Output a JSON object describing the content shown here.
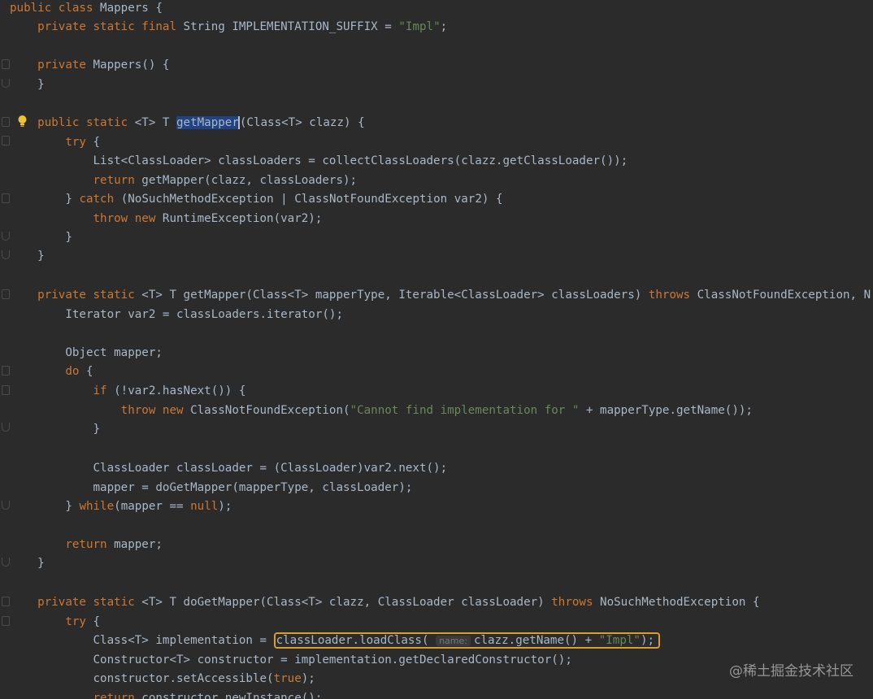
{
  "colors": {
    "background": "#2b2b2b",
    "text": "#a9b7c6",
    "keyword": "#cc7832",
    "string": "#6a8759",
    "selection": "#214283",
    "highlight_box": "#d99e2b"
  },
  "icons": {
    "intention": "lightbulb-icon"
  },
  "code": {
    "line_01": {
      "kw1": "public class",
      "rest": " Mappers {"
    },
    "line_02": {
      "indent": "    ",
      "kw1": "private static final",
      "mid": " String IMPLEMENTATION_SUFFIX = ",
      "str": "\"Impl\"",
      "end": ";"
    },
    "line_04": {
      "indent": "    ",
      "kw1": "private",
      "rest": " Mappers() {"
    },
    "line_05": {
      "indent": "    ",
      "rest": "}"
    },
    "line_07": {
      "indent": "    ",
      "kw1": "public static",
      "mid": " <T> T ",
      "selected": "getMapper",
      "rest": "(Class<T> clazz) {"
    },
    "line_08": {
      "indent": "        ",
      "kw1": "try",
      "rest": " {"
    },
    "line_09": {
      "indent": "            ",
      "rest": "List<ClassLoader> classLoaders = collectClassLoaders(clazz.getClassLoader());"
    },
    "line_10": {
      "indent": "            ",
      "kw1": "return",
      "rest": " getMapper(clazz, classLoaders);"
    },
    "line_11": {
      "indent": "        ",
      "pre": "} ",
      "kw1": "catch",
      "rest": " (NoSuchMethodException | ClassNotFoundException var2) {"
    },
    "line_12": {
      "indent": "            ",
      "kw1": "throw new",
      "rest": " RuntimeException(var2);"
    },
    "line_13": {
      "indent": "        ",
      "rest": "}"
    },
    "line_14": {
      "indent": "    ",
      "rest": "}"
    },
    "line_16": {
      "indent": "    ",
      "kw1": "private static",
      "mid": " <T> T getMapper(Class<T> mapperType, Iterable<ClassLoader> classLoaders) ",
      "kw2": "throws",
      "rest": " ClassNotFoundException, N"
    },
    "line_17": {
      "indent": "        ",
      "rest": "Iterator var2 = classLoaders.iterator();"
    },
    "line_19": {
      "indent": "        ",
      "rest": "Object mapper;"
    },
    "line_20": {
      "indent": "        ",
      "kw1": "do",
      "rest": " {"
    },
    "line_21": {
      "indent": "            ",
      "kw1": "if",
      "rest": " (!var2.hasNext()) {"
    },
    "line_22": {
      "indent": "                ",
      "kw1": "throw new",
      "mid": " ClassNotFoundException(",
      "str": "\"Cannot find implementation for \"",
      "rest": " + mapperType.getName());"
    },
    "line_23": {
      "indent": "            ",
      "rest": "}"
    },
    "line_25": {
      "indent": "            ",
      "rest": "ClassLoader classLoader = (ClassLoader)var2.next();"
    },
    "line_26": {
      "indent": "            ",
      "rest": "mapper = doGetMapper(mapperType, classLoader);"
    },
    "line_27": {
      "indent": "        ",
      "pre": "} ",
      "kw1": "while",
      "mid": "(mapper == ",
      "kw2": "null",
      "rest": ");"
    },
    "line_29": {
      "indent": "        ",
      "kw1": "return",
      "rest": " mapper;"
    },
    "line_30": {
      "indent": "    ",
      "rest": "}"
    },
    "line_32": {
      "indent": "    ",
      "kw1": "private static",
      "mid": " <T> T doGetMapper(Class<T> clazz, ClassLoader classLoader) ",
      "kw2": "throws",
      "rest": " NoSuchMethodException {"
    },
    "line_33": {
      "indent": "        ",
      "kw1": "try",
      "rest": " {"
    },
    "line_34": {
      "indent": "            ",
      "pre": "Class<T> implementation = ",
      "box_a": "classLoader.loadClass(",
      "hint": "name:",
      "box_b": "clazz.getName() + ",
      "str": "\"Impl\"",
      "box_c": ");"
    },
    "line_35": {
      "indent": "            ",
      "rest": "Constructor<T> constructor = implementation.getDeclaredConstructor();"
    },
    "line_36": {
      "indent": "            ",
      "pre": "constructor.setAccessible(",
      "kw1": "true",
      "rest": ");"
    },
    "line_37": {
      "indent": "            ",
      "kw1": "return",
      "rest": " constructor.newInstance();"
    }
  },
  "watermark": "@稀土掘金技术社区"
}
